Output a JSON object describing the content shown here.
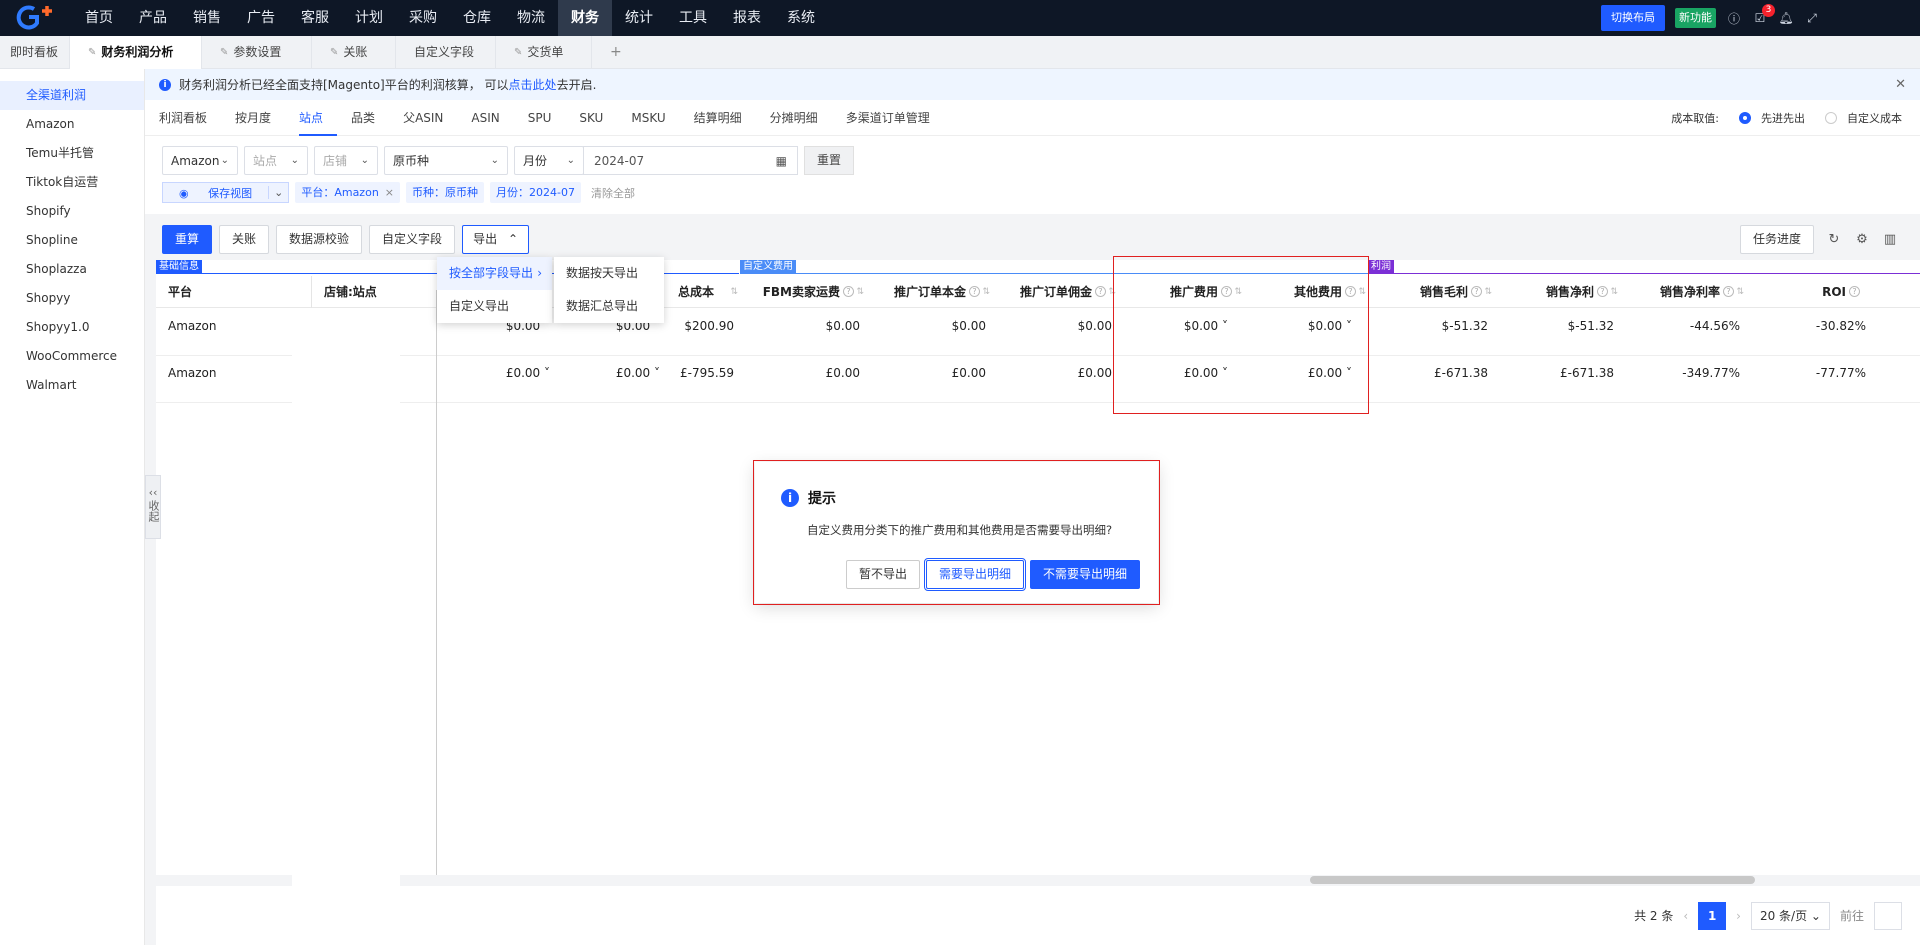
{
  "topnav": [
    "首页",
    "产品",
    "销售",
    "广告",
    "客服",
    "计划",
    "采购",
    "仓库",
    "物流",
    "财务",
    "统计",
    "工具",
    "报表",
    "系统"
  ],
  "topnav_active": "财务",
  "top_buttons": {
    "layout": "切换布局",
    "new": "新功能",
    "badge": "3"
  },
  "tabs": [
    "即时看板",
    "财务利润分析",
    "参数设置",
    "关账",
    "自定义字段",
    "交货单"
  ],
  "sidebar": [
    "全渠道利润",
    "Amazon",
    "Temu半托管",
    "Tiktok自运营",
    "Shopify",
    "Shopline",
    "Shoplazza",
    "Shopyy",
    "Shopyy1.0",
    "WooCommerce",
    "Walmart"
  ],
  "notice": {
    "text_before": "财务利润分析已经全面支持[Magento]平台的利润核算， 可以",
    "link": "点击此处",
    "text_after": "去开启."
  },
  "subtabs": [
    "利润看板",
    "按月度",
    "站点",
    "品类",
    "父ASIN",
    "ASIN",
    "SPU",
    "SKU",
    "MSKU",
    "结算明细",
    "分摊明细",
    "多渠道订单管理"
  ],
  "subtab_active": "站点",
  "cost": {
    "label": "成本取值:",
    "opt1": "先进先出",
    "opt2": "自定义成本"
  },
  "filters": {
    "platform": "Amazon",
    "site": "站点",
    "store": "店铺",
    "currency": "原币种",
    "period": "月份",
    "date": "2024-07",
    "reset": "重置"
  },
  "chips": {
    "save_view": "保存视图",
    "platform": "平台：Amazon",
    "currency": "币种：原币种",
    "month": "月份：2024-07",
    "clear": "清除全部"
  },
  "toolbar": {
    "recalc": "重算",
    "close": "关账",
    "verify": "数据源校验",
    "custom": "自定义字段",
    "export": "导出",
    "task": "任务进度"
  },
  "export_menu": {
    "all": "按全部字段导出",
    "custom": "自定义导出",
    "daily": "数据按天导出",
    "summary": "数据汇总导出"
  },
  "groups": {
    "basic": "基础信息",
    "custom_fee": "自定义费用",
    "profit": "利润"
  },
  "columns": [
    "平台",
    "店铺:站点",
    "总成本",
    "FBM卖家运费",
    "推广订单本金",
    "推广订单佣金",
    "推广费用",
    "其他费用",
    "销售毛利",
    "销售净利",
    "销售净利率",
    "ROI"
  ],
  "rows": [
    {
      "platform": "Amazon",
      "c1": "$0.00",
      "c2": "$0.00",
      "total_cost": "$200.90",
      "fbm": "$0.00",
      "promo_principal": "$0.00",
      "promo_comm": "$0.00",
      "promo_fee": "$0.00",
      "other_fee": "$0.00",
      "gross": "$-51.32",
      "net": "$-51.32",
      "net_rate": "-44.56%",
      "roi": "-30.82%"
    },
    {
      "platform": "Amazon",
      "c1": "£0.00",
      "c2": "£0.00",
      "total_cost": "£-795.59",
      "fbm": "£0.00",
      "promo_principal": "£0.00",
      "promo_comm": "£0.00",
      "promo_fee": "£0.00",
      "other_fee": "£0.00",
      "gross": "£-671.38",
      "net": "£-671.38",
      "net_rate": "-349.77%",
      "roi": "-77.77%"
    }
  ],
  "pager": {
    "total": "共 2 条",
    "page": "1",
    "size": "20 条/页",
    "goto": "前往"
  },
  "collapse": "收起",
  "dialog": {
    "title": "提示",
    "message": "自定义费用分类下的推广费用和其他费用是否需要导出明细?",
    "no": "暂不导出",
    "need": "需要导出明细",
    "noneed": "不需要导出明细"
  },
  "colors": {
    "primary": "#1f5bff",
    "topbar": "#0e1726",
    "basic_group": "#1f5bff",
    "custom_group": "#4a8cf7",
    "profit_group": "#7b2fd6",
    "highlight": "#e02020"
  }
}
